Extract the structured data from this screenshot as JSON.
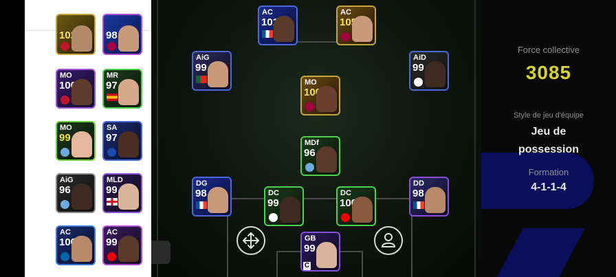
{
  "team_panel": {
    "force_label": "Force collective",
    "force_value": "3085",
    "style_label": "Style de jeu d'équipe",
    "style_value_line1": "Jeu de",
    "style_value_line2": "possession",
    "formation_label": "Formation",
    "formation_value": "4-1-1-4"
  },
  "pitch_cards": [
    {
      "pos": "AC",
      "rating": "101",
      "flag": "france"
    },
    {
      "pos": "AC",
      "rating": "105",
      "flag": "none"
    },
    {
      "pos": "AiG",
      "rating": "99",
      "flag": "portugal"
    },
    {
      "pos": "AiD",
      "rating": "99",
      "flag": "none"
    },
    {
      "pos": "MO",
      "rating": "100",
      "flag": "none"
    },
    {
      "pos": "MDf",
      "rating": "96",
      "flag": "none"
    },
    {
      "pos": "DG",
      "rating": "98",
      "flag": "france"
    },
    {
      "pos": "DC",
      "rating": "99",
      "flag": "none"
    },
    {
      "pos": "DC",
      "rating": "100",
      "flag": "none"
    },
    {
      "pos": "DD",
      "rating": "98",
      "flag": "france"
    },
    {
      "pos": "GB",
      "rating": "99",
      "flag": "none"
    }
  ],
  "bench_cards": [
    {
      "pos": "",
      "rating": "102"
    },
    {
      "pos": "",
      "rating": "98"
    },
    {
      "pos": "MO",
      "rating": "100"
    },
    {
      "pos": "MR",
      "rating": "97"
    },
    {
      "pos": "MO",
      "rating": "99"
    },
    {
      "pos": "SA",
      "rating": "97"
    },
    {
      "pos": "AiG",
      "rating": "96"
    },
    {
      "pos": "MLD",
      "rating": "99"
    },
    {
      "pos": "AC",
      "rating": "100"
    },
    {
      "pos": "AC",
      "rating": "99"
    }
  ],
  "gk_badge": "C",
  "colors": {
    "accent_yellow": "#d7d52b",
    "navy": "#0a0f5c"
  }
}
